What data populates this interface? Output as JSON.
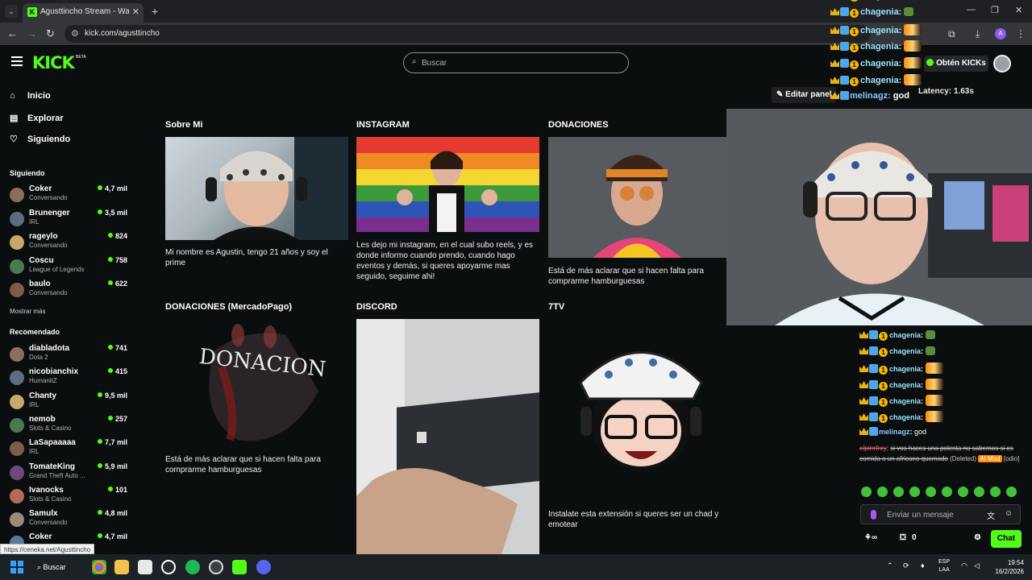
{
  "browser": {
    "tab_title": "Agusttincho Stream - Watch Li",
    "tab_favicon": "K",
    "tab_close": "✕",
    "new_tab": "+",
    "url": "kick.com/agusttincho",
    "status_url": "https://ceneka.net/Agusttincho"
  },
  "kick": {
    "logo": "KICK",
    "beta": "BETA",
    "search_placeholder": "Buscar",
    "obten_kicks": "Obtén KICKs"
  },
  "sidebar": {
    "nav": [
      {
        "label": "Inicio",
        "icon": "home-icon"
      },
      {
        "label": "Explorar",
        "icon": "explore-icon"
      },
      {
        "label": "Siguiendo",
        "icon": "heart-icon"
      }
    ],
    "following_title": "Siguiendo",
    "following": [
      {
        "name": "Coker",
        "category": "Conversando",
        "viewers": "4,7 mil"
      },
      {
        "name": "Brunenger",
        "category": "IRL",
        "viewers": "3,5 mil"
      },
      {
        "name": "rageylo",
        "category": "Conversando",
        "viewers": "824"
      },
      {
        "name": "Coscu",
        "category": "League of Legends",
        "viewers": "758"
      },
      {
        "name": "baulo",
        "category": "Conversando",
        "viewers": "622"
      }
    ],
    "show_more": "Mostrar más",
    "recommended_title": "Recomendado",
    "recommended": [
      {
        "name": "diabladota",
        "category": "Dota 2",
        "viewers": "741"
      },
      {
        "name": "nicobianchix",
        "category": "HumanitZ",
        "viewers": "415"
      },
      {
        "name": "Chanty",
        "category": "IRL",
        "viewers": "9,5 mil"
      },
      {
        "name": "nemob",
        "category": "Slots & Casino",
        "viewers": "257"
      },
      {
        "name": "LaSapaaaaa",
        "category": "IRL",
        "viewers": "7,7 mil"
      },
      {
        "name": "TomateKing",
        "category": "Grand Theft Auto ...",
        "viewers": "5,9 mil"
      },
      {
        "name": "Ivanocks",
        "category": "Slots & Casino",
        "viewers": "101"
      },
      {
        "name": "Samulx",
        "category": "Conversando",
        "viewers": "4,8 mil"
      },
      {
        "name": "Coker",
        "category": "",
        "viewers": "4,7 mil"
      }
    ]
  },
  "panels": [
    {
      "title": "Sobre Mi",
      "text": "Mi nombre es Agustin, tengo 21 años y soy el prime"
    },
    {
      "title": "INSTAGRAM",
      "text": "Les dejo mi instagram, en el cual subo reels, y es donde informo cuando prendo, cuando hago eventos y demás, si queres apoyarme mas seguido, seguime ahi!"
    },
    {
      "title": "DONACIONES",
      "text": "Está de más aclarar que si hacen falta para comprarme hamburguesas"
    },
    {
      "title": "DONACIONES (MercadoPago)",
      "text": "Está de más aclarar que si hacen falta para comprarme hamburguesas",
      "image_text": "DONACION"
    },
    {
      "title": "DISCORD",
      "text": ""
    },
    {
      "title": "7TV",
      "text": "Instalate esta extensión si queres ser un chad y emotear"
    }
  ],
  "edit_panel": "Editar panel",
  "overlay": {
    "latency": "Latency: 1.63s",
    "lines": [
      {
        "user": "chagenia:",
        "emote": "frog"
      },
      {
        "user": "chagenia:",
        "emote": "fire"
      },
      {
        "user": "chagenia:",
        "emote": "fire"
      },
      {
        "user": "chagenia:",
        "emote": "fire"
      },
      {
        "user": "chagenia:",
        "emote": "fire"
      },
      {
        "user": "melinagz:",
        "text": "god"
      }
    ],
    "top_partial": "chagenia:"
  },
  "chat": {
    "lines": [
      {
        "user": "chagenia",
        "emote": "frog"
      },
      {
        "user": "chagenia",
        "emote": "frog"
      },
      {
        "user": "chagenia",
        "emote": "fire"
      },
      {
        "user": "chagenia",
        "emote": "fire"
      },
      {
        "user": "chagenia",
        "emote": "fire"
      },
      {
        "user": "chagenia",
        "emote": "fire"
      },
      {
        "user": "melinagz",
        "text": "god"
      }
    ],
    "deleted_user": "elpirrrfrey",
    "deleted_text": "si vos haces una polenta no sabemos si es comida o un africano quemado",
    "deleted_tag": "(Deleted)",
    "mod_tag": "AI Mod",
    "odio_tag": "[odio]",
    "input_placeholder": "Enviar un mensaje",
    "points": "0",
    "chat_button": "Chat"
  },
  "taskbar": {
    "search": "Buscar",
    "lang_1": "ESP",
    "lang_2": "LAA",
    "time": "19:54",
    "date": "16/2/2026"
  },
  "colors": {
    "kick_green": "#53fc18",
    "bg": "#0b0e0f"
  }
}
